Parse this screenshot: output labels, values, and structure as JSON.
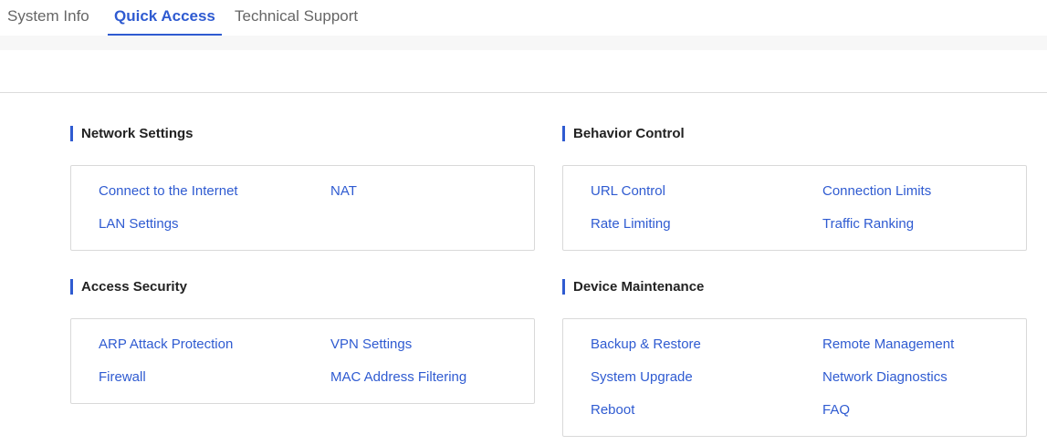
{
  "tabs": [
    {
      "label": "System Info",
      "active": false
    },
    {
      "label": "Quick Access",
      "active": true
    },
    {
      "label": "Technical Support",
      "active": false
    }
  ],
  "sections": {
    "network_settings": {
      "title": "Network Settings",
      "links": [
        "Connect to the Internet",
        "NAT",
        "LAN Settings"
      ]
    },
    "behavior_control": {
      "title": "Behavior Control",
      "links": [
        "URL Control",
        "Connection Limits",
        "Rate Limiting",
        "Traffic Ranking"
      ]
    },
    "access_security": {
      "title": "Access Security",
      "links": [
        "ARP Attack Protection",
        "VPN Settings",
        "Firewall",
        "MAC Address Filtering"
      ]
    },
    "device_maintenance": {
      "title": "Device Maintenance",
      "links": [
        "Backup & Restore",
        "Remote Management",
        "System Upgrade",
        "Network Diagnostics",
        "Reboot",
        "FAQ"
      ]
    }
  },
  "colors": {
    "accent": "#2f5bd1",
    "tab_inactive": "#666666",
    "border": "#d9d9d9"
  }
}
